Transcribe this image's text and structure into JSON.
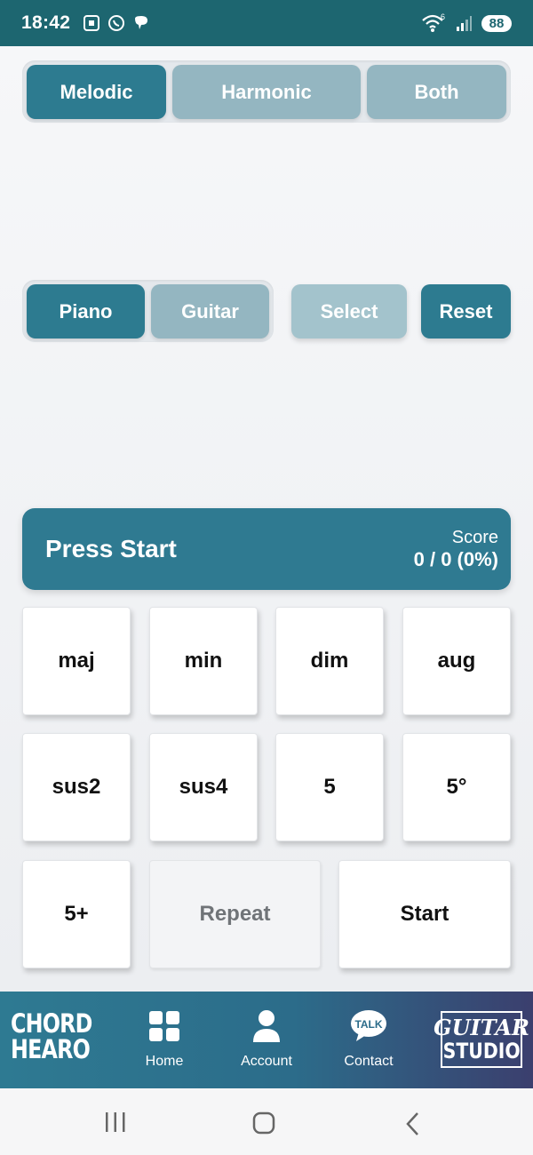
{
  "status_bar": {
    "time": "18:42",
    "battery": "88",
    "network": "6"
  },
  "mode_tabs": [
    {
      "label": "Melodic",
      "active": true
    },
    {
      "label": "Harmonic",
      "active": false
    },
    {
      "label": "Both",
      "active": false
    }
  ],
  "instrument_tabs": [
    {
      "label": "Piano",
      "active": true
    },
    {
      "label": "Guitar",
      "active": false
    }
  ],
  "actions": {
    "select_label": "Select",
    "reset_label": "Reset"
  },
  "score_banner": {
    "title": "Press Start",
    "score_label": "Score",
    "score_value": "0 / 0 (0%)"
  },
  "chord_buttons": [
    "maj",
    "min",
    "dim",
    "aug",
    "sus2",
    "sus4",
    "5",
    "5°",
    "5+"
  ],
  "controls": {
    "repeat_label": "Repeat",
    "start_label": "Start"
  },
  "bottom_nav": {
    "logo_left": [
      "CHORD",
      "HEARO"
    ],
    "items": [
      {
        "label": "Home",
        "icon": "home-grid-icon"
      },
      {
        "label": "Account",
        "icon": "account-icon"
      },
      {
        "label": "Contact",
        "icon": "talk-bubble-icon",
        "icon_text": "TALK"
      }
    ],
    "logo_right": [
      "GUITAR",
      "STUDIO"
    ]
  },
  "colors": {
    "primary": "#2d7b90",
    "inactive": "#94b6c1",
    "status_bar": "#1d6670"
  }
}
